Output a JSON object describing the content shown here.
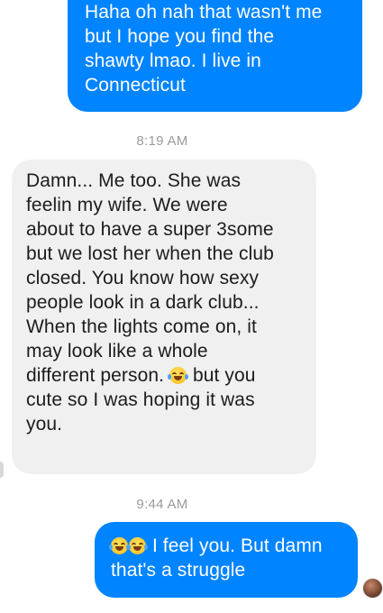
{
  "messages": [
    {
      "direction": "outgoing",
      "lines": [
        "Haha oh nah that wasn't me",
        "but I hope you find the",
        "shawty lmao. I live in",
        "Connecticut"
      ]
    },
    {
      "direction": "incoming",
      "lines": [
        "Damn... Me too. She was",
        "feelin my wife. We were",
        "about to have a super 3some",
        "but we lost her when the club",
        "closed.  You know how sexy",
        "people look in a dark club...",
        "When the lights come on, it",
        "may look like a whole",
        "different person.",
        "but you",
        "cute so I was hoping it was",
        "you."
      ],
      "emoji": "face-with-tears-of-joy"
    },
    {
      "direction": "outgoing",
      "lines": [
        "I feel you. But damn",
        "that's a struggle"
      ],
      "emoji": "face-with-tears-of-joy"
    }
  ],
  "timestamps": [
    "8:19 AM",
    "9:44 AM"
  ],
  "colors": {
    "outgoing_bubble": "#0084ff",
    "incoming_bubble": "#f1f0f0",
    "timestamp_text": "#9a9a9a"
  },
  "icons": {
    "laugh_emoji": "face-with-tears-of-joy-icon",
    "sender_avatar": "avatar"
  }
}
